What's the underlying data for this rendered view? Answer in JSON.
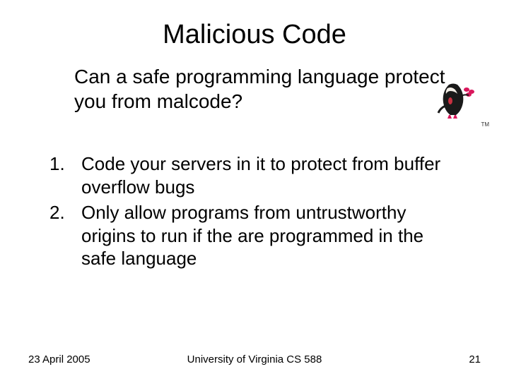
{
  "title": "Malicious Code",
  "question": "Can a safe programming language protect you from malcode?",
  "items": [
    "Code your servers in it to protect from buffer overflow bugs",
    "Only allow programs from untrustworthy origins to run if the are programmed in the safe language"
  ],
  "footer": {
    "date": "23 April 2005",
    "center": "University of Virginia CS 588",
    "page": "21"
  },
  "mascot": {
    "name": "duke-mascot",
    "tm": "TM"
  }
}
